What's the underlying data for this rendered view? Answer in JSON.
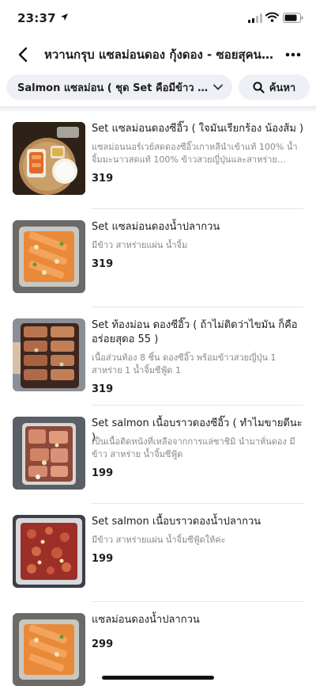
{
  "status_bar": {
    "time": "23:37"
  },
  "header": {
    "title": "หวานกรุบ แซลม่อนดอง กุ้งดอง - ซอยสุคน..."
  },
  "filter": {
    "category_label": "Salmon แซลม่อน ( ชุด Set คือมีข้าว ซี...",
    "search_label": "ค้นหา"
  },
  "items": [
    {
      "name": "Set แซลม่อนดองซีอิ๊ว ( ใจมันเรียกร้อง น้องส้ม )",
      "description": "แซลม่อนนอร์เวย์สดดองซีอิ๊วเกาหลีนำเข้าแท้ 100% น้ำจิ้มมะนาวสดแท้ 100% ข้าวสวยญี่ปุ่นและสาหร่าย ต้อง...",
      "price": "319"
    },
    {
      "name": "Set แซลม่อนดองน้ำปลากวน",
      "description": "มีข้าว สาหร่ายแผ่น น้ำจิ้ม",
      "price": "319"
    },
    {
      "name": "Set ท้องม่อน ดองซีอิ๊ว ( ถ้าไม่ติดว่าไขมัน ก็คืออร่อยสุดอ 55 )",
      "description": "เนื้อส่วนท้อง 8 ชิ้น ดองซีอิ๊ว พร้อมข้าวสวยญี่ปุ่น 1 สาหร่าย 1 น้ำจิ้มซีฟู้ด 1",
      "price": "319"
    },
    {
      "name": "Set salmon เนื้อบราวดองซีอิ๊ว ( ทำไมขายดีนะ )",
      "description": "เป็นเนื้อติดหนังที่เหลือจากการแล่ซาชิมิ นำมาหั่นดอง มีข้าว สาหร่าย น้ำจิ้มซีฟู้ด",
      "price": "199"
    },
    {
      "name": "Set salmon เนื้อบราวดองน้ำปลากวน",
      "description": "มีข้าว สาหร่ายแผ่น น้ำจิ้มซีฟู้ดให้ค่ะ",
      "price": "199"
    },
    {
      "name": "แซลม่อนดองน้ำปลากวน",
      "description": "",
      "price": "299"
    }
  ]
}
